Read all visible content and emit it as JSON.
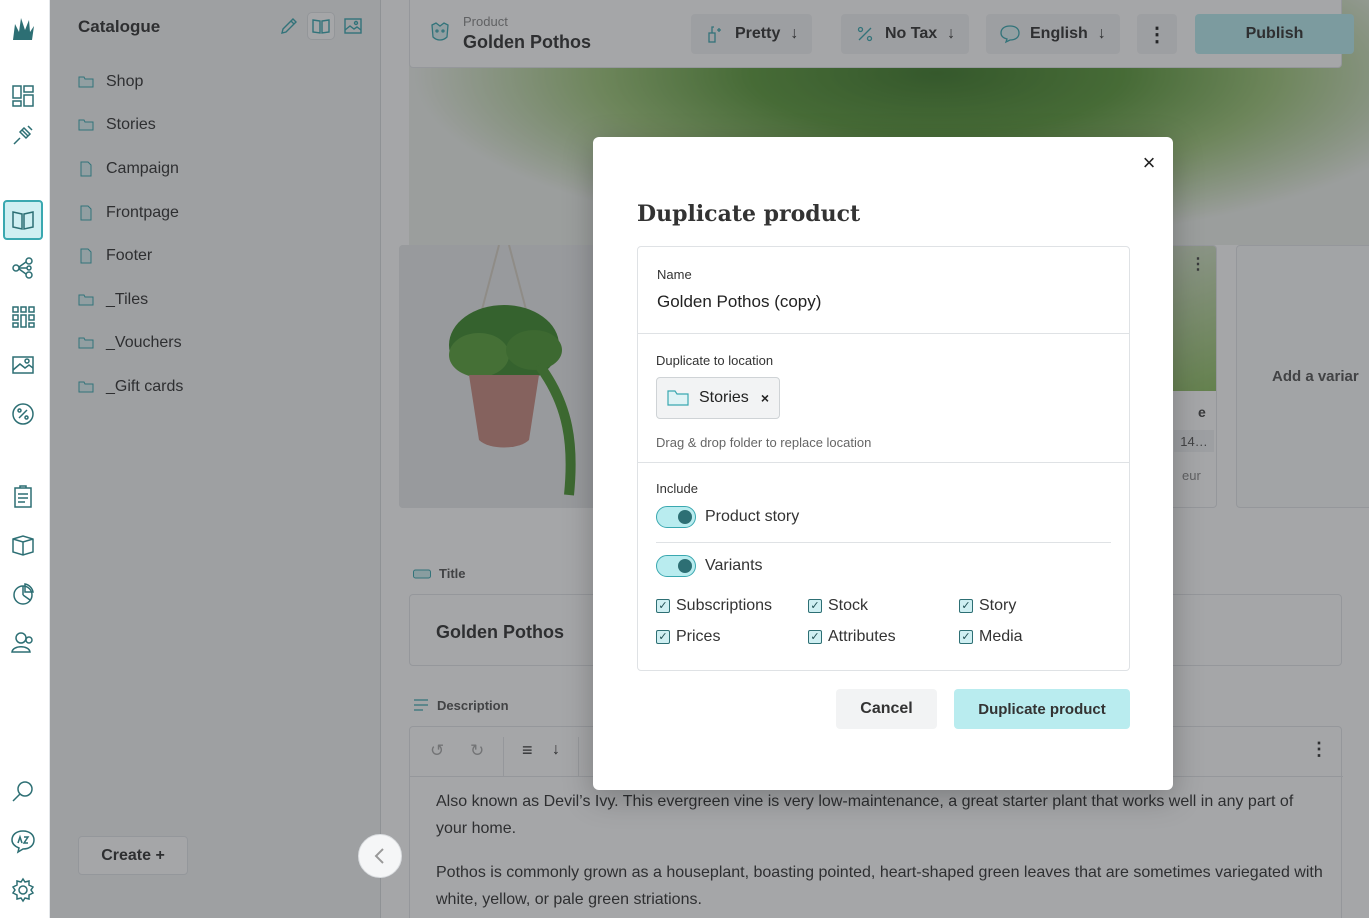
{
  "sidebar": {
    "title": "Catalogue",
    "items": [
      {
        "label": "Shop",
        "icon": "folder-icon"
      },
      {
        "label": "Stories",
        "icon": "folder-icon"
      },
      {
        "label": "Campaign",
        "icon": "document-icon"
      },
      {
        "label": "Frontpage",
        "icon": "document-icon"
      },
      {
        "label": "Footer",
        "icon": "document-icon"
      },
      {
        "label": "_Tiles",
        "icon": "folder-icon"
      },
      {
        "label": "_Vouchers",
        "icon": "folder-icon"
      },
      {
        "label": "_Gift cards",
        "icon": "folder-icon"
      }
    ],
    "create_label": "Create +"
  },
  "header": {
    "type_label": "Product",
    "product_name": "Golden Pothos",
    "format_label": "Pretty",
    "tax_label": "No Tax",
    "language_label": "English",
    "publish_label": "Publish"
  },
  "variant": {
    "price_truncated": "14…",
    "currency": "eur",
    "name_fragment": "e"
  },
  "add_variant_label": "Add a variar",
  "fields": {
    "title_label": "Title",
    "title_value": "Golden Pothos",
    "description_label": "Description",
    "description_paragraphs": [
      "Also known as Devil’s Ivy. This evergreen vine is very low-maintenance, a great starter plant that works well in any part of your home.",
      "Pothos is commonly grown as a houseplant, boasting pointed, heart-shaped green leaves that are sometimes variegated with white, yellow, or pale green striations."
    ]
  },
  "modal": {
    "title": "Duplicate product",
    "name_label": "Name",
    "name_value": "Golden Pothos (copy)",
    "location_label": "Duplicate to location",
    "location_value": "Stories",
    "location_hint": "Drag & drop folder to replace location",
    "include_label": "Include",
    "toggles": {
      "product_story": {
        "label": "Product story",
        "on": true
      },
      "variants": {
        "label": "Variants",
        "on": true
      }
    },
    "checkboxes": [
      {
        "label": "Subscriptions",
        "checked": true
      },
      {
        "label": "Stock",
        "checked": true
      },
      {
        "label": "Story",
        "checked": true
      },
      {
        "label": "Prices",
        "checked": true
      },
      {
        "label": "Attributes",
        "checked": true
      },
      {
        "label": "Media",
        "checked": true
      }
    ],
    "cancel_label": "Cancel",
    "confirm_label": "Duplicate product"
  },
  "colors": {
    "accent": "#3aa8b0",
    "accent_light": "#b9ecef",
    "accent_dark": "#2d6f74"
  }
}
